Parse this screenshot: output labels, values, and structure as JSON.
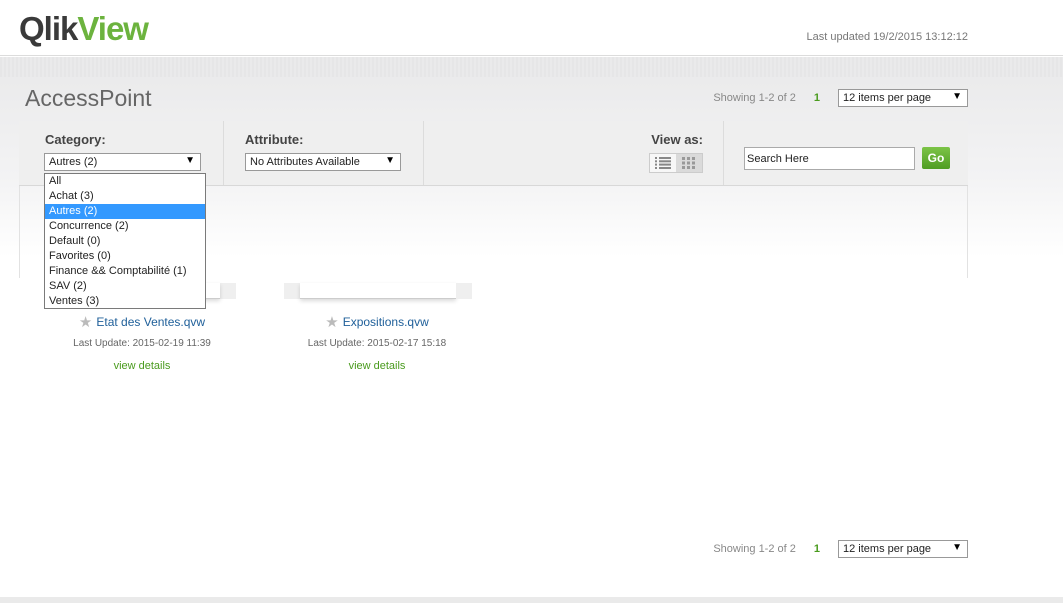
{
  "header": {
    "logo_left": "Qlik",
    "logo_right": "View",
    "last_updated": "Last updated 19/2/2015 13:12:12"
  },
  "page": {
    "title": "AccessPoint"
  },
  "pager": {
    "showing": "Showing 1-2 of 2",
    "page_number": "1",
    "per_page": "12 items per page"
  },
  "toolbar": {
    "category_label": "Category:",
    "category_value": "Autres (2)",
    "attribute_label": "Attribute:",
    "attribute_value": "No Attributes Available",
    "view_as_label": "View as:",
    "view_icons": [
      "list-view-icon",
      "grid-view-icon"
    ],
    "active_view": "grid",
    "search_placeholder": "Search Here",
    "go_label": "Go"
  },
  "category_options": [
    "All",
    "Achat (3)",
    "Autres (2)",
    "Concurrence (2)",
    "Default (0)",
    "Favorites (0)",
    "Finance && Comptabilité (1)",
    "SAV (2)",
    "Ventes (3)"
  ],
  "selected_category_index": 2,
  "documents": [
    {
      "name": "Etat des Ventes.qvw",
      "updated": "Last Update: 2015-02-19 11:39",
      "details": "view details"
    },
    {
      "name": "Expositions.qvw",
      "updated": "Last Update: 2015-02-17 15:18",
      "details": "view details"
    }
  ],
  "colors": {
    "accent_green": "#6cb33e",
    "link_blue": "#20609a",
    "selection_blue": "#3399ff"
  }
}
